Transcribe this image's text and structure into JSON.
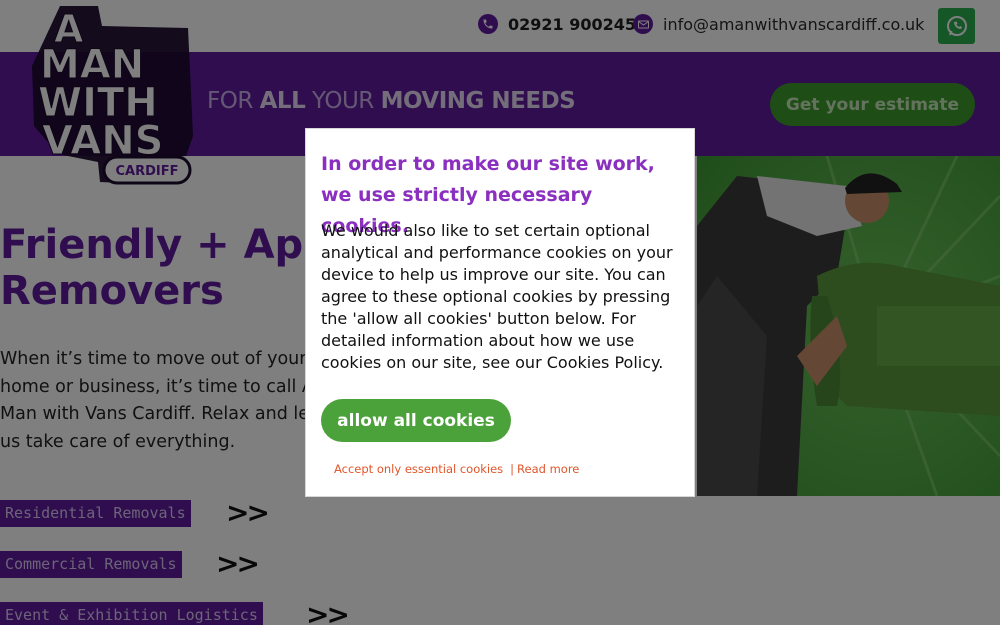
{
  "header": {
    "phone": "02921 900245",
    "email": "info@amanwithvanscardiff.co.uk",
    "phone_icon": "phone-icon",
    "email_icon": "envelope-icon",
    "whatsapp_icon": "whatsapp-icon"
  },
  "logo": {
    "line1": "A",
    "line2": "MAN",
    "line3": "WITH",
    "line4": "VANS",
    "badge": "CARDIFF"
  },
  "band": {
    "tagline_part1": "FOR ",
    "tagline_bold1": "ALL",
    "tagline_part2": " YOUR ",
    "tagline_bold2": "MOVING NEEDS",
    "estimate_button": "Get your estimate"
  },
  "hero": {
    "title_line1": "Friendly + Appr",
    "title_line2": "Removers",
    "text": "When it’s time to move out of your home or business, it’s time to call A Man with Vans Cardiff. Relax and let us take care of everything."
  },
  "services": [
    {
      "label": "Residential Removals",
      "arrows": ">>"
    },
    {
      "label": "Commercial Removals",
      "arrows": ">>"
    },
    {
      "label": "Event & Exhibition Logistics",
      "arrows": ">>"
    }
  ],
  "cookie_modal": {
    "title": "In order to make our site work, we use strictly necessary cookies.",
    "body": "We would also like to set certain optional analytical and performance cookies on your device to help us improve our site. You can agree to these optional cookies by pressing the 'allow all cookies' button below. For detailed information about how we use cookies on our site, see our Cookies Policy.",
    "allow_button": "allow all cookies",
    "essential_link": "Accept only essential cookies",
    "separator": "|",
    "read_more_link": "Read more"
  },
  "colors": {
    "brand_purple": "#5e1a9e",
    "brand_green": "#4ca23a",
    "link_orange": "#e0552a",
    "modal_title": "#8a2fbf"
  }
}
